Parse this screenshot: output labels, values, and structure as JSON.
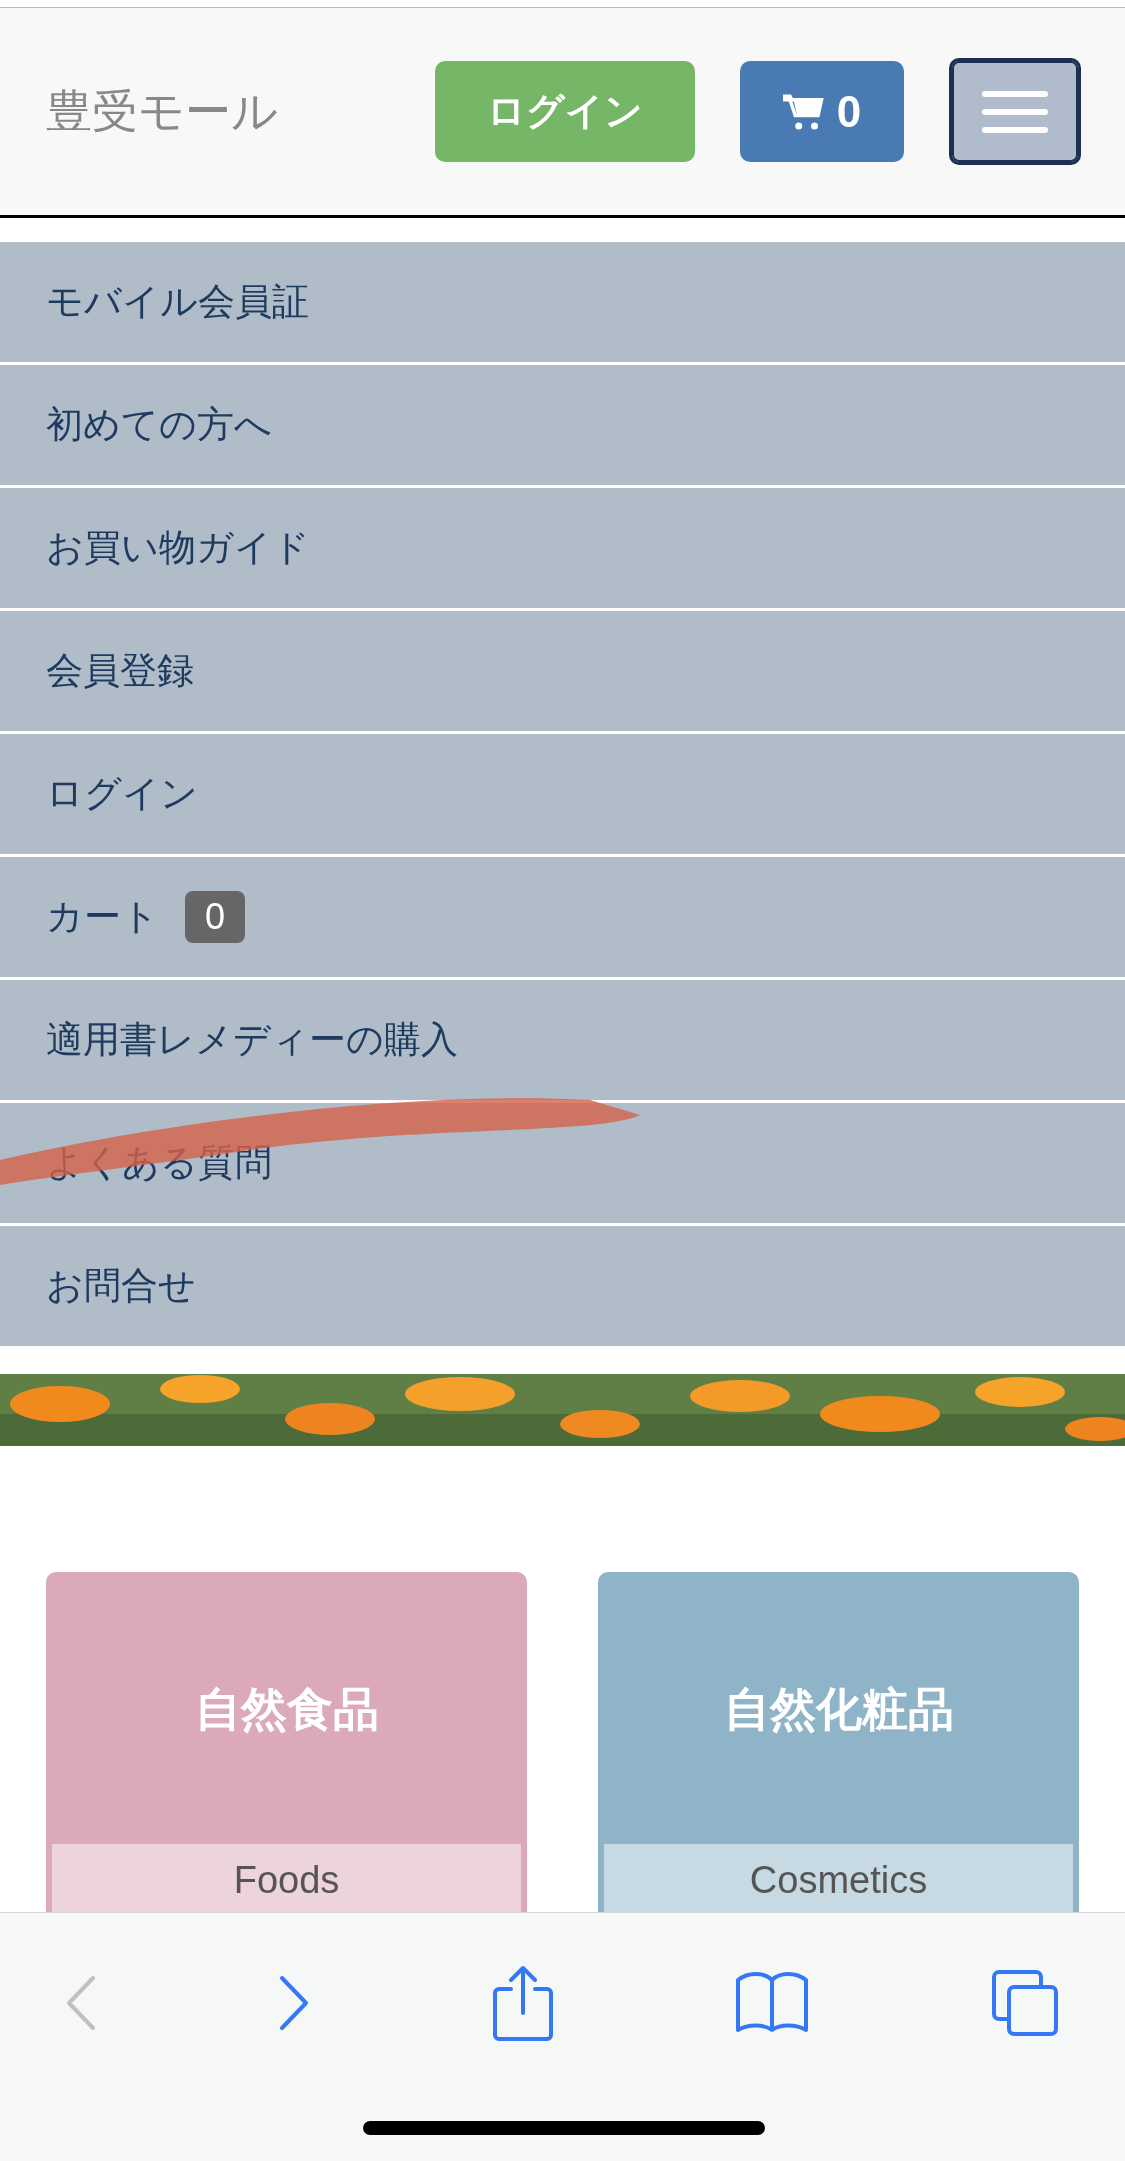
{
  "header": {
    "logo": "豊受モール",
    "login_button": "ログイン",
    "cart_button": {
      "count": "0"
    }
  },
  "menu": {
    "expanded": true,
    "items": [
      {
        "label": "モバイル会員証"
      },
      {
        "label": "初めての方へ"
      },
      {
        "label": "お買い物ガイド"
      },
      {
        "label": "会員登録"
      },
      {
        "label": "ログイン"
      },
      {
        "label": "カート",
        "badge": "0"
      },
      {
        "label": "適用書レメディーの購入"
      },
      {
        "label": "よくある質問"
      },
      {
        "label": "お問合せ"
      }
    ]
  },
  "categories": [
    {
      "title": "自然食品",
      "subtitle": "Foods",
      "color": "#dba9b7"
    },
    {
      "title": "自然化粧品",
      "subtitle": "Cosmetics",
      "color": "#8fb4c8"
    }
  ],
  "browser_toolbar": {
    "back": {
      "disabled": true
    },
    "forward": {
      "disabled": false
    }
  }
}
